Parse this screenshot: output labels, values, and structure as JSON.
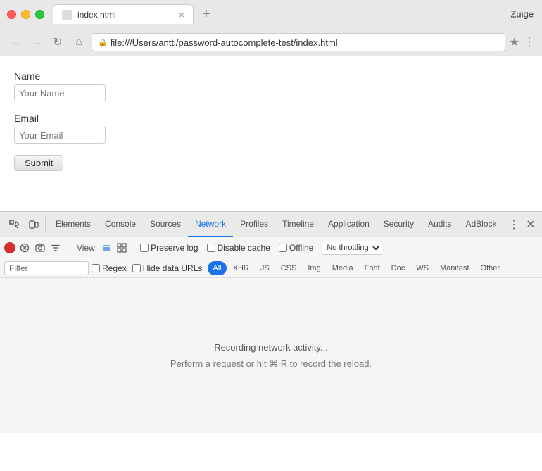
{
  "browser": {
    "profile": "Zuige",
    "tab": {
      "title": "index.html",
      "url": "file:///Users/antti/password-autocomplete-test/index.html"
    }
  },
  "page": {
    "name_label": "Name",
    "name_placeholder": "Your Name",
    "email_label": "Email",
    "email_placeholder": "Your Email",
    "submit_label": "Submit"
  },
  "devtools": {
    "tabs": [
      "Elements",
      "Console",
      "Sources",
      "Network",
      "Profiles",
      "Timeline",
      "Application",
      "Security",
      "Audits",
      "AdBlock"
    ],
    "active_tab": "Network",
    "toolbar": {
      "view_label": "View:",
      "preserve_log_label": "Preserve log",
      "disable_cache_label": "Disable cache",
      "offline_label": "Offline",
      "throttle_default": "No throttling"
    },
    "filter": {
      "placeholder": "Filter",
      "regex_label": "Regex",
      "hide_data_urls_label": "Hide data URLs",
      "type_btns": [
        "All",
        "XHR",
        "JS",
        "CSS",
        "Img",
        "Media",
        "Font",
        "Doc",
        "WS",
        "Manifest",
        "Other"
      ]
    },
    "network_status": {
      "recording": "Recording network activity...",
      "hint": "Perform a request or hit ⌘ R to record the reload."
    }
  }
}
